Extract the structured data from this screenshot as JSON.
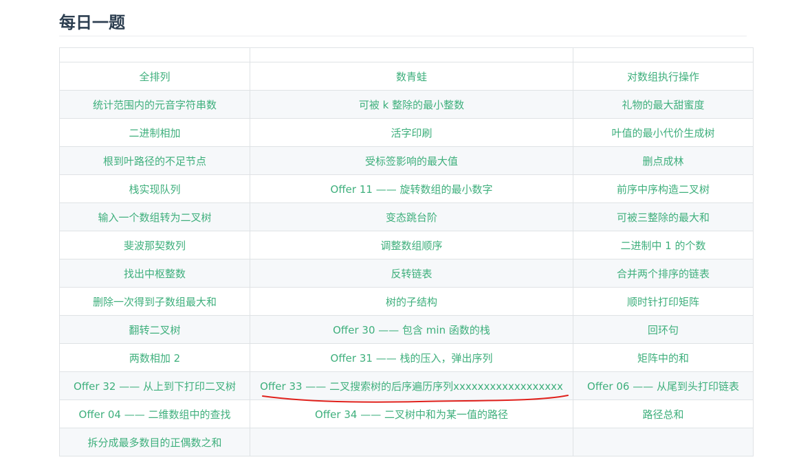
{
  "page": {
    "title": "每日一题"
  },
  "table": {
    "rows": [
      [
        "全排列",
        "数青蛙",
        "对数组执行操作"
      ],
      [
        "统计范围内的元音字符串数",
        "可被 k 整除的最小整数",
        "礼物的最大甜蜜度"
      ],
      [
        "二进制相加",
        "活字印刷",
        "叶值的最小代价生成树"
      ],
      [
        "根到叶路径的不足节点",
        "受标签影响的最大值",
        "删点成林"
      ],
      [
        "栈实现队列",
        "Offer 11 —— 旋转数组的最小数字",
        "前序中序构造二叉树"
      ],
      [
        "输入一个数组转为二叉树",
        "变态跳台阶",
        "可被三整除的最大和"
      ],
      [
        "斐波那契数列",
        "调整数组顺序",
        "二进制中 1 的个数"
      ],
      [
        "找出中枢整数",
        "反转链表",
        "合并两个排序的链表"
      ],
      [
        "删除一次得到子数组最大和",
        "树的子结构",
        "顺时针打印矩阵"
      ],
      [
        "翻转二叉树",
        "Offer 30 —— 包含 min 函数的栈",
        "回环句"
      ],
      [
        "两数相加 2",
        "Offer 31 —— 栈的压入，弹出序列",
        "矩阵中的和"
      ],
      [
        "Offer 32 —— 从上到下打印二叉树",
        "Offer 33 —— 二叉搜索树的后序遍历序列xxxxxxxxxxxxxxxxxx",
        "Offer 06 —— 从尾到头打印链表"
      ],
      [
        "Offer 04 —— 二维数组中的查找",
        "Offer 34 —— 二叉树中和为某一值的路径",
        "路径总和"
      ],
      [
        "拆分成最多数目的正偶数之和",
        "",
        ""
      ]
    ]
  },
  "colors": {
    "link": "#3eaf7c",
    "border": "#dfe2e5",
    "stripe": "#f6f8fa",
    "annotation": "#e0201b"
  }
}
